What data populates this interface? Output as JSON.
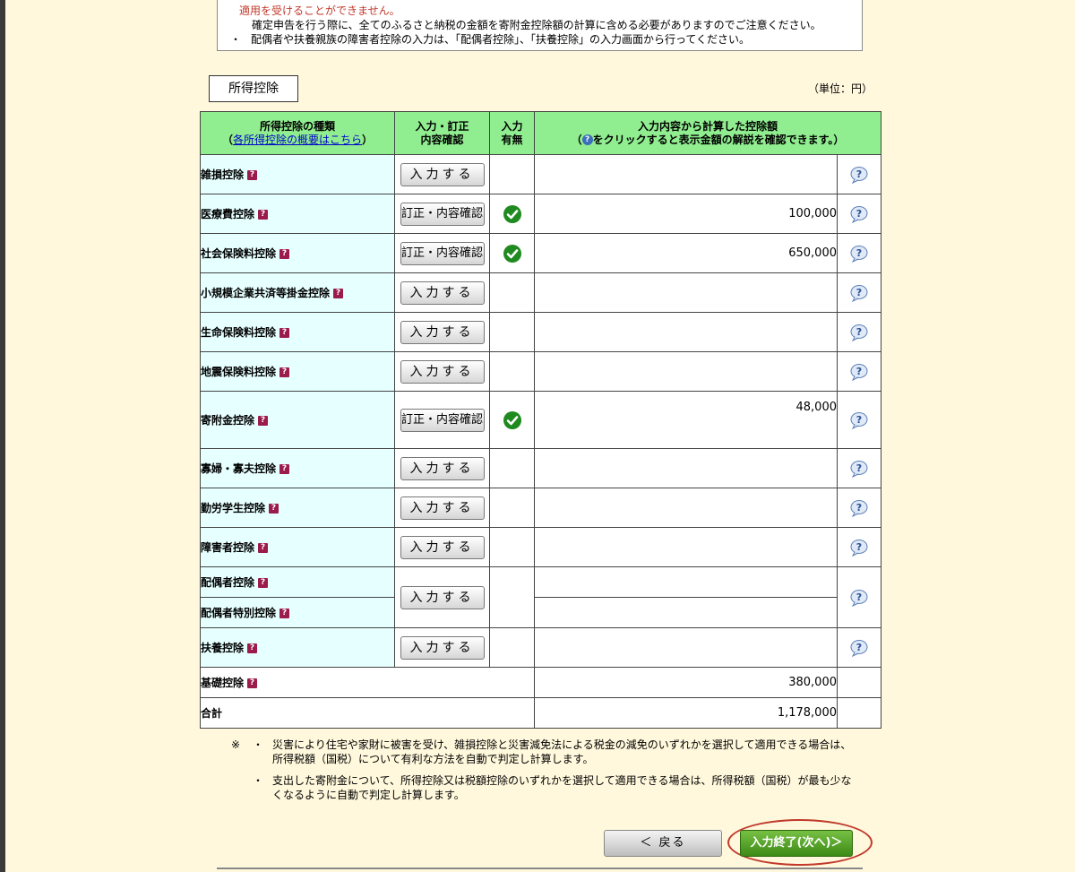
{
  "notice": {
    "line1": "適用を受けることができません。",
    "line2": "確定申告を行う際に、全てのふるさと納税の金額を寄附金控除額の計算に含める必要がありますのでご注意ください。",
    "bullet": "・",
    "line3": "配偶者や扶養親族の障害者控除の入力は、「配偶者控除」、「扶養控除」の入力画面から行ってください。"
  },
  "section_title": "所得控除",
  "unit": "（単位：円）",
  "table": {
    "headers": {
      "type_label": "所得控除の種類",
      "overview_open": "（",
      "overview_link": "各所得控除の概要はこちら",
      "overview_close": "）",
      "input_label_1": "入力・訂正",
      "input_label_2": "内容確認",
      "status_label_1": "入力",
      "status_label_2": "有無",
      "amount_label_1": "入力内容から計算した控除額",
      "amount_label_2a": "（",
      "amount_label_2b": "をクリックすると表示金額の解説を確認できます。）"
    },
    "help_glyph": "?",
    "rows": [
      {
        "name": "雑損控除",
        "button": "入力する",
        "done": false,
        "amount": ""
      },
      {
        "name": "医療費控除",
        "button": "訂正・内容確認",
        "done": true,
        "amount": "100,000"
      },
      {
        "name": "社会保険料控除",
        "button": "訂正・内容確認",
        "done": true,
        "amount": "650,000"
      },
      {
        "name": "小規模企業共済等掛金控除",
        "button": "入力する",
        "done": false,
        "amount": ""
      },
      {
        "name": "生命保険料控除",
        "button": "入力する",
        "done": false,
        "amount": ""
      },
      {
        "name": "地震保険料控除",
        "button": "入力する",
        "done": false,
        "amount": ""
      },
      {
        "name": "寄附金控除",
        "button": "訂正・内容確認",
        "done": true,
        "amount": "48,000"
      },
      {
        "name": "寡婦・寡夫控除",
        "button": "入力する",
        "done": false,
        "amount": ""
      },
      {
        "name": "勤労学生控除",
        "button": "入力する",
        "done": false,
        "amount": ""
      },
      {
        "name": "障害者控除",
        "button": "入力する",
        "done": false,
        "amount": ""
      },
      {
        "name": "配偶者控除",
        "name2": "配偶者特別控除",
        "button": "入力する",
        "done": false,
        "amount": ""
      },
      {
        "name": "扶養控除",
        "button": "入力する",
        "done": false,
        "amount": ""
      }
    ],
    "basic": {
      "name": "基礎控除",
      "amount": "380,000"
    },
    "total": {
      "name": "合計",
      "amount": "1,178,000"
    }
  },
  "notes": {
    "mark": "※",
    "dot": "・",
    "note1": "災害により住宅や家財に被害を受け、雑損控除と災害減免法による税金の減免のいずれかを選択して適用できる場合は、所得税額（国税）について有利な方法を自動で判定し計算します。",
    "note2": "支出した寄附金について、所得控除又は税額控除のいずれかを選択して適用できる場合は、所得税額（国税）が最も少なくなるように自動で判定し計算します。"
  },
  "buttons": {
    "back": "＜ 戻る",
    "next": "入力終了(次へ)＞"
  },
  "colors": {
    "header_bg": "#90ee90",
    "name_bg": "#e6ffff",
    "page_bg": "#fff8dc",
    "check": "#1f8a1f"
  }
}
